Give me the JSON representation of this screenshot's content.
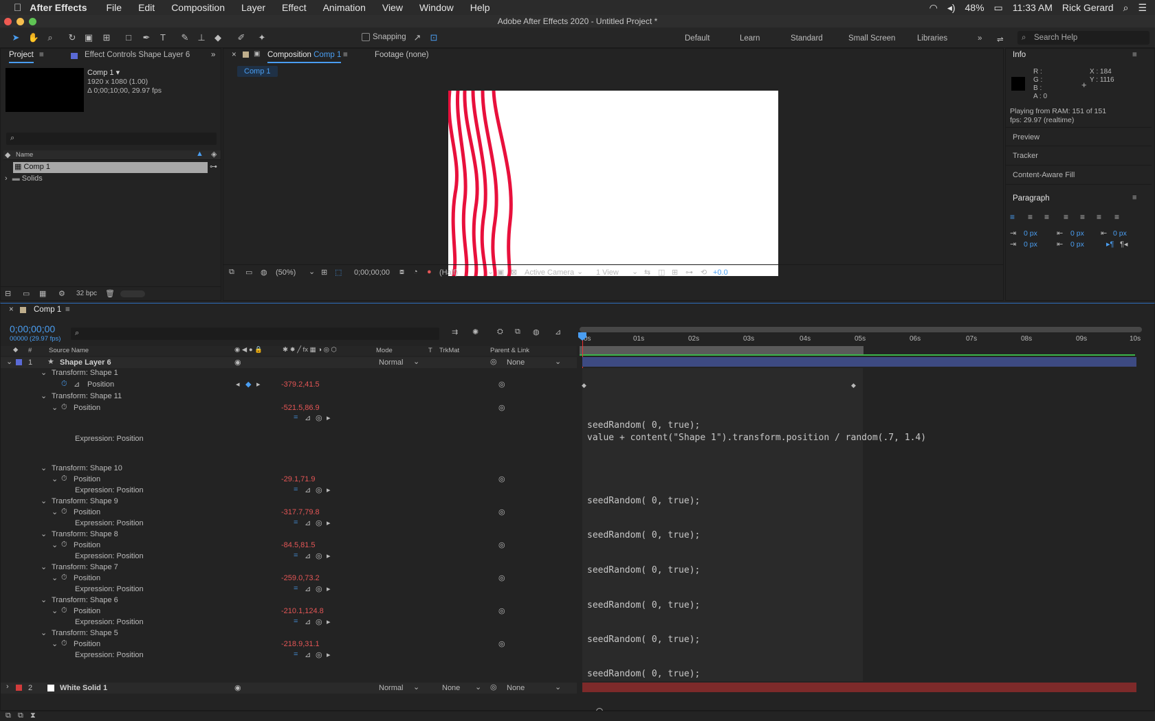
{
  "menubar": {
    "apple": "",
    "app": "After Effects",
    "items": [
      "File",
      "Edit",
      "Composition",
      "Layer",
      "Effect",
      "Animation",
      "View",
      "Window",
      "Help"
    ],
    "battery": "48%",
    "time": "11:33 AM",
    "user": "Rick Gerard"
  },
  "window": {
    "title": "Adobe After Effects 2020 - Untitled Project *"
  },
  "toolbar": {
    "snapping": "Snapping",
    "workspaces": [
      "Default",
      "Learn",
      "Standard",
      "Small Screen",
      "Libraries"
    ],
    "search_placeholder": "Search Help"
  },
  "project": {
    "tab": "Project",
    "effect_tab": "Effect Controls Shape Layer 6",
    "comp_name": "Comp 1 ▾",
    "comp_dims": "1920 x 1080 (1.00)",
    "comp_duration": "Δ 0;00;10;00, 29.97 fps",
    "col_name": "Name",
    "items": [
      "Comp 1",
      "Solids"
    ],
    "bpc": "32 bpc"
  },
  "viewer": {
    "tab_prefix": "Composition",
    "tab_comp": "Comp 1",
    "footage_tab": "Footage (none)",
    "breadcrumb": "Comp 1",
    "zoom": "(50%)",
    "timecode": "0;00;00;00",
    "resolution": "(Half)",
    "camera": "Active Camera",
    "views": "1 View",
    "exposure": "+0.0"
  },
  "info": {
    "title": "Info",
    "r": "R :",
    "g": "G :",
    "b": "B :",
    "a": "A :  0",
    "x": "X : 184",
    "y": "Y : 1116",
    "ram": "Playing from RAM: 151 of 151",
    "fps": "fps: 29.97 (realtime)",
    "sections": [
      "Preview",
      "Tracker",
      "Content-Aware Fill"
    ],
    "paragraph": "Paragraph",
    "px": [
      "0 px",
      "0 px",
      "0 px",
      "0 px",
      "0 px"
    ]
  },
  "timeline": {
    "tab": "Comp 1",
    "timecode": "0;00;00;00",
    "frames": "00000 (29.97 fps)",
    "headers": {
      "hash": "#",
      "source": "Source Name",
      "mode": "Mode",
      "t": "T",
      "trkmat": "TrkMat",
      "parent": "Parent & Link"
    },
    "ruler": [
      "0s",
      "01s",
      "02s",
      "03s",
      "04s",
      "05s",
      "06s",
      "07s",
      "08s",
      "09s",
      "10s"
    ],
    "layer1": {
      "num": "1",
      "name": "Shape Layer 6",
      "mode": "Normal",
      "parent": "None"
    },
    "layer2": {
      "num": "2",
      "name": "White Solid 1",
      "mode": "Normal",
      "trkmat": "None",
      "parent": "None"
    },
    "groups": [
      {
        "title": "Transform: Shape 1",
        "value": "-379.2,41.5"
      },
      {
        "title": "Transform: Shape 11",
        "value": "-521.5,86.9"
      },
      {
        "title": "Transform: Shape 10",
        "value": "-29.1,71.9"
      },
      {
        "title": "Transform: Shape 9",
        "value": "-317.7,79.8"
      },
      {
        "title": "Transform: Shape 8",
        "value": "-84.5,81.5"
      },
      {
        "title": "Transform: Shape 7",
        "value": "-259.0,73.2"
      },
      {
        "title": "Transform: Shape 6",
        "value": "-210.1,124.8"
      },
      {
        "title": "Transform: Shape 5",
        "value": "-218.9,31.1"
      }
    ],
    "position_label": "Position",
    "expr_label": "Expression: Position",
    "expr_main_1": "seedRandom( 0, true);",
    "expr_main_2": "value + content(\"Shape 1\").transform.position / random(.7, 1.4)",
    "expr_short": "seedRandom( 0, true);"
  },
  "colors": {
    "accent": "#4a9ef2",
    "red_value": "#e55656",
    "layer_bar": "#3d4a82",
    "solid_bar": "#7d2a2a",
    "curve": "#e8103c"
  }
}
